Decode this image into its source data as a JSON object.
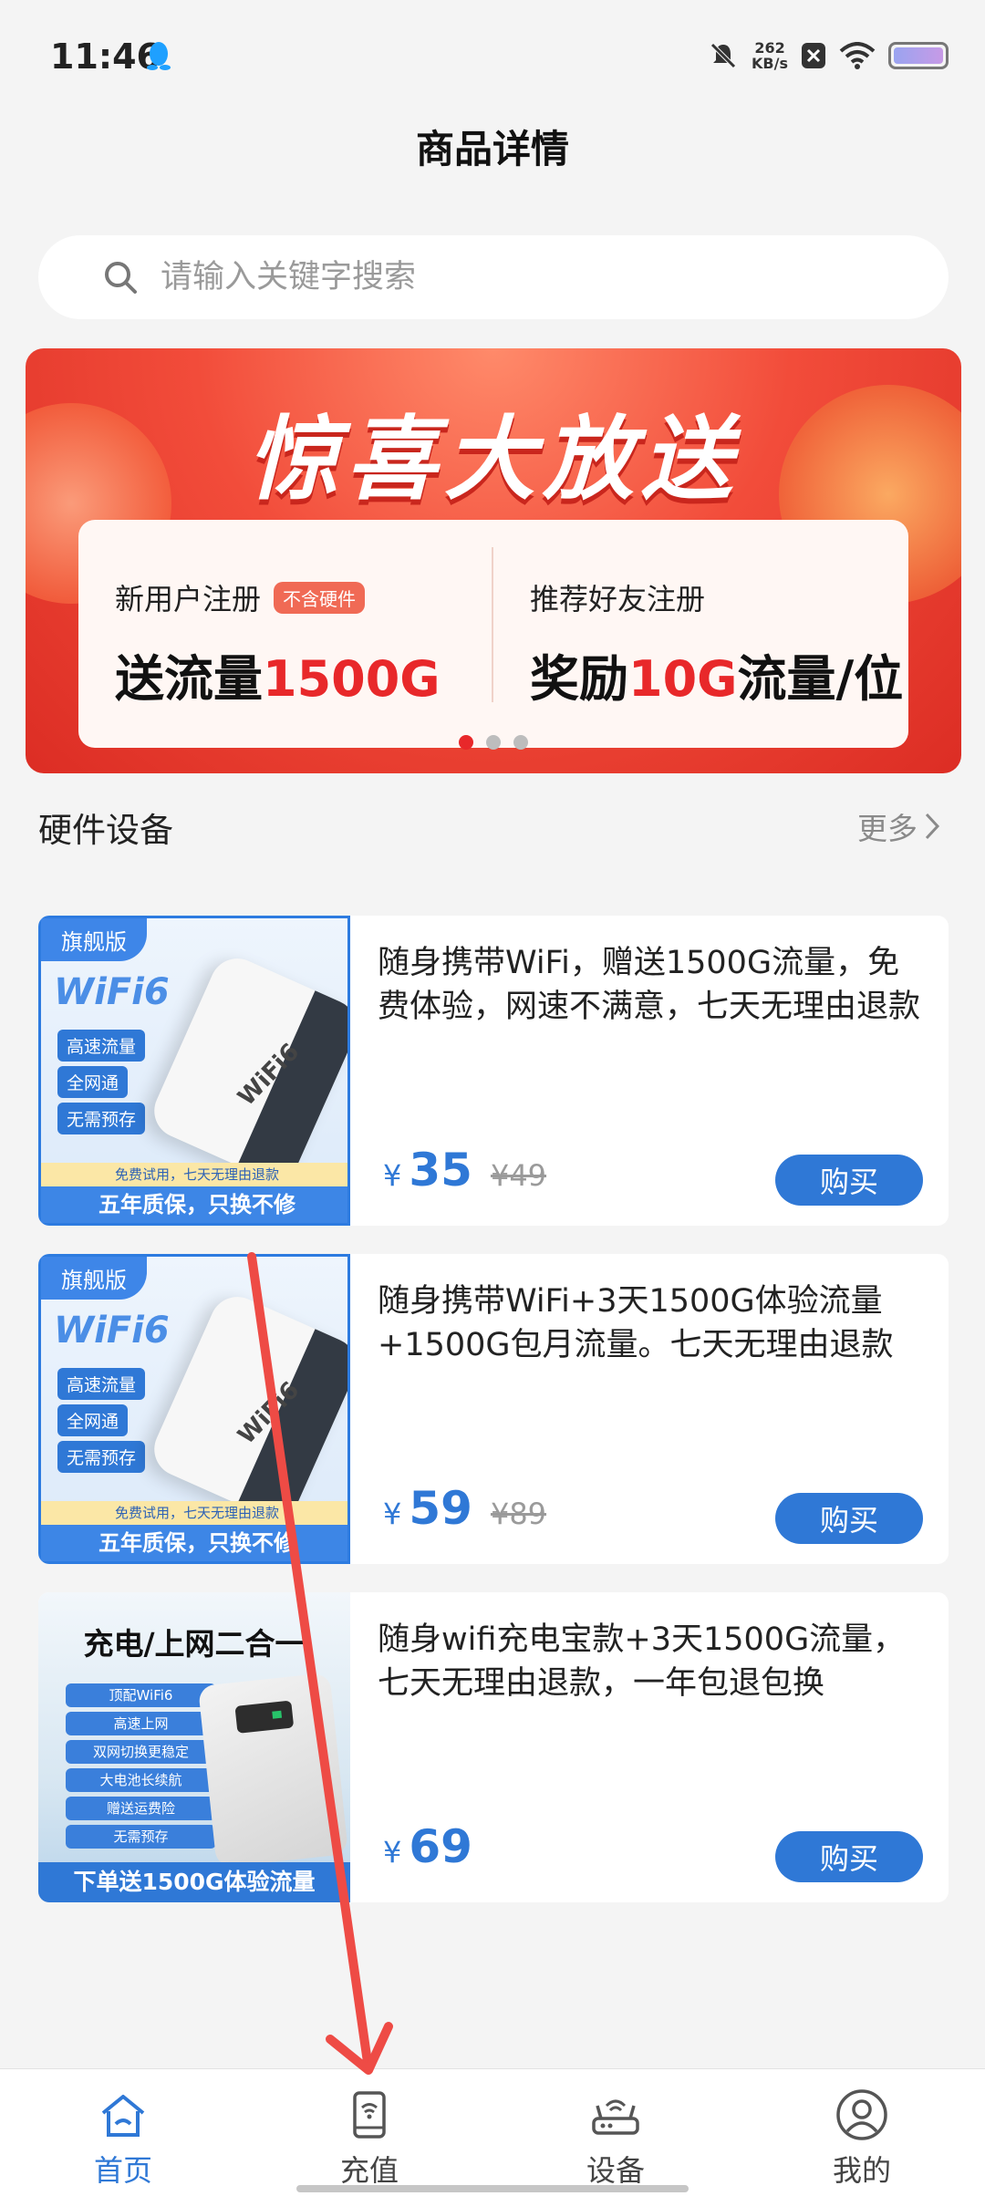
{
  "status_bar": {
    "time": "11:46",
    "net_speed_value": "262",
    "net_speed_unit": "KB/s"
  },
  "header": {
    "title": "商品详情"
  },
  "search": {
    "placeholder": "请输入关键字搜索"
  },
  "banner": {
    "headline": "惊喜大放送",
    "left_label": "新用户注册",
    "left_tag": "不含硬件",
    "left_big_prefix": "送流量",
    "left_big_highlight": "1500G",
    "right_label": "推荐好友注册",
    "right_big_prefix": "奖励",
    "right_big_highlight": "10G",
    "right_big_suffix": "流量/位",
    "active_slide": 1,
    "slide_count": 3
  },
  "section": {
    "title": "硬件设备",
    "more": "更多"
  },
  "products": [
    {
      "flag": "旗舰版",
      "logo": "WiFi6",
      "features": [
        "高速流量",
        "全网通",
        "无需预存"
      ],
      "device_text": "WiFi6",
      "strip_yellow": "免费试用，七天无理由退款",
      "strip_blue": "五年质保，只换不修",
      "desc": "随身携带WiFi，赠送1500G流量，免费体验，网速不满意，七天无理由退款",
      "price_symbol": "¥",
      "price": "35",
      "old_price": "¥49",
      "buy": "购买"
    },
    {
      "flag": "旗舰版",
      "logo": "WiFi6",
      "features": [
        "高速流量",
        "全网通",
        "无需预存"
      ],
      "device_text": "WiFi6",
      "strip_yellow": "免费试用，七天无理由退款",
      "strip_blue": "五年质保，只换不修",
      "desc": "随身携带WiFi+3天1500G体验流量+1500G包月流量。七天无理由退款",
      "price_symbol": "¥",
      "price": "59",
      "old_price": "¥89",
      "buy": "购买"
    },
    {
      "power_title": "充电/上网二合一",
      "power_features": [
        "顶配WiFi6",
        "高速上网",
        "双网切换更稳定",
        "大电池长续航",
        "赠送运费险",
        "无需预存"
      ],
      "power_strip": "下单送1500G体验流量",
      "desc": "随身wifi充电宝款+3天1500G流量，七天无理由退款，一年包退包换",
      "price_symbol": "¥",
      "price": "69",
      "buy": "购买"
    }
  ],
  "tab_bar": {
    "tabs": [
      {
        "label": "首页",
        "icon": "home-icon",
        "active": true
      },
      {
        "label": "充值",
        "icon": "recharge-icon",
        "active": false
      },
      {
        "label": "设备",
        "icon": "router-icon",
        "active": false
      },
      {
        "label": "我的",
        "icon": "profile-icon",
        "active": false
      }
    ]
  },
  "colors": {
    "accent": "#2f78d6",
    "banner_red": "#e8282a",
    "annotation_arrow": "#ee4b45"
  }
}
